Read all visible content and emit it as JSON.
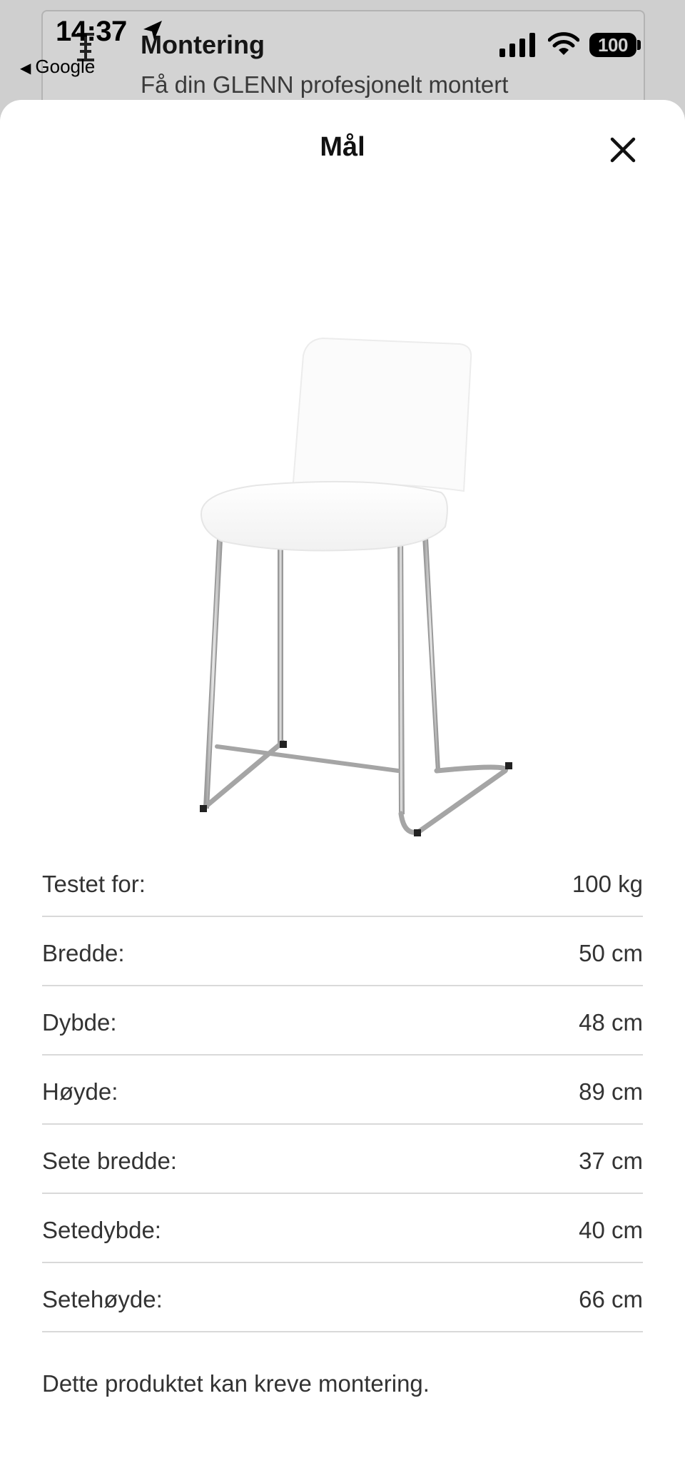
{
  "status_bar": {
    "time": "14:37",
    "back_label": "Google",
    "battery": "100"
  },
  "background_page": {
    "title": "Montering",
    "subtitle": "Få din GLENN profesjonelt montert"
  },
  "sheet": {
    "title": "Mål",
    "close_icon": "close-icon",
    "product_image": "white bar stool with chrome legs",
    "dimensions": [
      {
        "label": "Testet for:",
        "value": "100 kg"
      },
      {
        "label": "Bredde:",
        "value": "50 cm"
      },
      {
        "label": "Dybde:",
        "value": "48 cm"
      },
      {
        "label": "Høyde:",
        "value": "89 cm"
      },
      {
        "label": "Sete bredde:",
        "value": "37 cm"
      },
      {
        "label": "Setedybde:",
        "value": "40 cm"
      },
      {
        "label": "Setehøyde:",
        "value": "66 cm"
      }
    ],
    "note": "Dette produktet kan kreve montering."
  }
}
